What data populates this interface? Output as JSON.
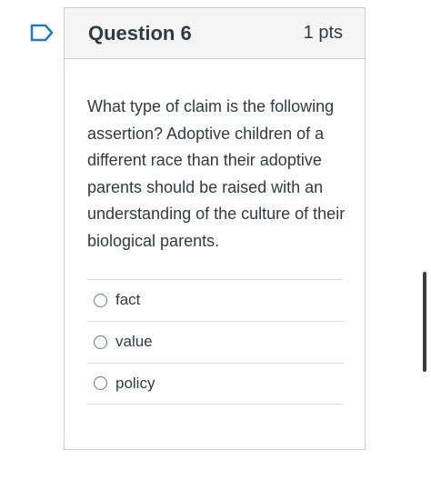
{
  "question": {
    "title": "Question 6",
    "points": "1 pts",
    "text": "What type of claim is the following assertion? Adoptive children of a different race than their adoptive parents should be raised with an understanding of the culture of their biological parents.",
    "flag_icon": "flag-icon",
    "flag_color": "#2b7abc"
  },
  "answers": [
    {
      "label": "fact",
      "selected": false
    },
    {
      "label": "value",
      "selected": false
    },
    {
      "label": "policy",
      "selected": false
    }
  ],
  "colors": {
    "header_bg": "#f5f5f5",
    "border": "#c7cdd1",
    "text": "#2d3b45"
  }
}
